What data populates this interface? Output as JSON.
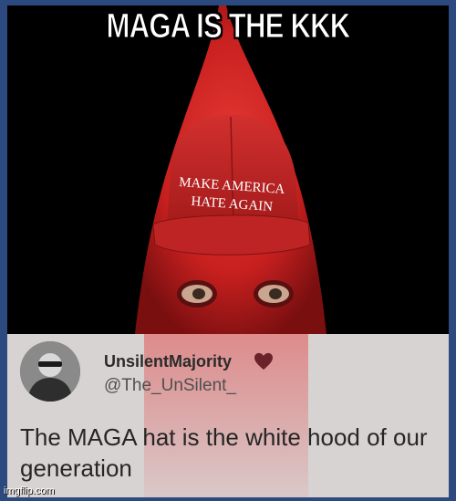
{
  "meme": {
    "top_text": "MAGA IS THE KKK",
    "hat_text_line1": "MAKE AMERICA",
    "hat_text_line2": "HATE AGAIN"
  },
  "tweet": {
    "display_name": "UnsilentMajority",
    "handle": "@The_UnSilent_",
    "text": "The MAGA hat is the white hood of our generation",
    "heart_icon": "heart-icon",
    "heart_color": "#6b2228"
  },
  "watermark": "imgflip.com",
  "colors": {
    "frame": "#2d4a80",
    "hood_red": "#d42a2a",
    "photo_bg": "#000000",
    "tweet_bg": "#d8d3d3"
  }
}
